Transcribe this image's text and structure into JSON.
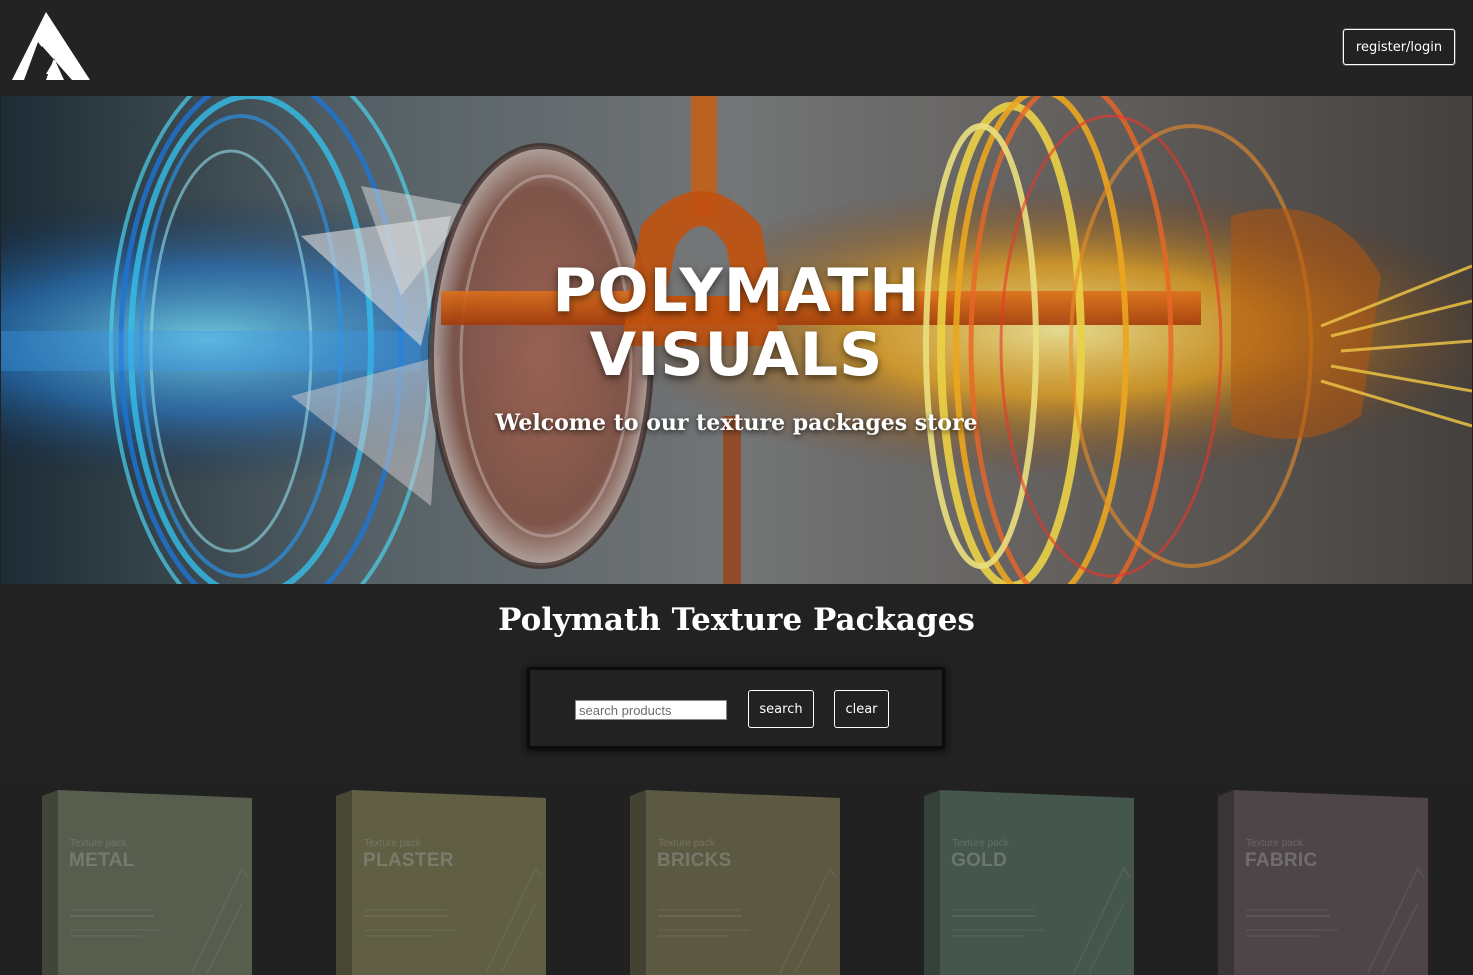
{
  "header": {
    "logo_icon": "polymath-triangle-logo-icon",
    "auth_label": "register/login"
  },
  "hero": {
    "title_line1": "POLYMATH",
    "title_line2": "VISUALS",
    "tagline": "Welcome to our texture packages store"
  },
  "products_section": {
    "title": "Polymath Texture Packages",
    "search": {
      "placeholder": "search products",
      "value": "",
      "search_label": "search",
      "clear_label": "clear"
    },
    "products": [
      {
        "pack_label": "Texture pack",
        "name": "METAL",
        "color": "#808a6e"
      },
      {
        "pack_label": "Texture pack",
        "name": "PLASTER",
        "color": "#8e8c5c"
      },
      {
        "pack_label": "Texture pack",
        "name": "BRICKS",
        "color": "#87815a"
      },
      {
        "pack_label": "Texture pack",
        "name": "GOLD",
        "color": "#5f7c6c"
      },
      {
        "pack_label": "Texture pack",
        "name": "FABRIC",
        "color": "#6e6064"
      }
    ]
  }
}
